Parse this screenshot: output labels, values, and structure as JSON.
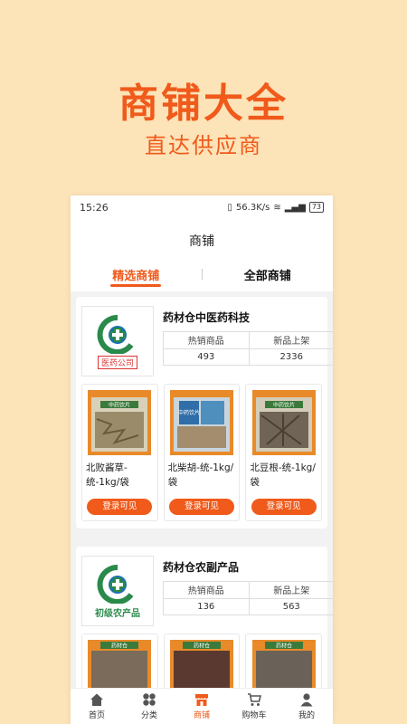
{
  "banner": {
    "title": "商铺大全",
    "subtitle": "直达供应商"
  },
  "status": {
    "time": "15:26",
    "speed": "56.3K/s",
    "battery": "73"
  },
  "navbar": {
    "title": "商铺"
  },
  "tabs": [
    {
      "label": "精选商铺",
      "active": true
    },
    {
      "label": "全部商铺",
      "active": false
    }
  ],
  "shops": [
    {
      "name": "药材仓中医药科技",
      "logo_caption": "医药公司",
      "stats": [
        {
          "label": "热销商品",
          "value": "493"
        },
        {
          "label": "新品上架",
          "value": "2336"
        }
      ],
      "products": [
        {
          "name": "北败酱草-统-1kg/袋",
          "button": "登录可见",
          "bag_label": "中药饮片"
        },
        {
          "name": "北柴胡-统-1kg/袋",
          "button": "登录可见",
          "bag_label": "中药饮片"
        },
        {
          "name": "北豆根-统-1kg/袋",
          "button": "登录可见",
          "bag_label": "中药饮片"
        }
      ]
    },
    {
      "name": "药材仓农副产品",
      "logo_caption": "初级农产品",
      "stats": [
        {
          "label": "热销商品",
          "value": "136"
        },
        {
          "label": "新品上架",
          "value": "563"
        }
      ],
      "products": [
        {
          "name": "",
          "button": "",
          "bag_label": "药材仓"
        },
        {
          "name": "",
          "button": "",
          "bag_label": "药材仓"
        },
        {
          "name": "",
          "button": "",
          "bag_label": "药材仓"
        }
      ]
    }
  ],
  "tabbar": [
    {
      "label": "首页",
      "icon": "home-icon",
      "active": false
    },
    {
      "label": "分类",
      "icon": "category-icon",
      "active": false
    },
    {
      "label": "商铺",
      "icon": "store-icon",
      "active": true
    },
    {
      "label": "购物车",
      "icon": "cart-icon",
      "active": false
    },
    {
      "label": "我的",
      "icon": "user-icon",
      "active": false
    }
  ],
  "colors": {
    "accent": "#f05a1a",
    "background": "#fde3b8",
    "logo_green": "#2a8a4a",
    "logo_blue": "#1b6fb3"
  }
}
